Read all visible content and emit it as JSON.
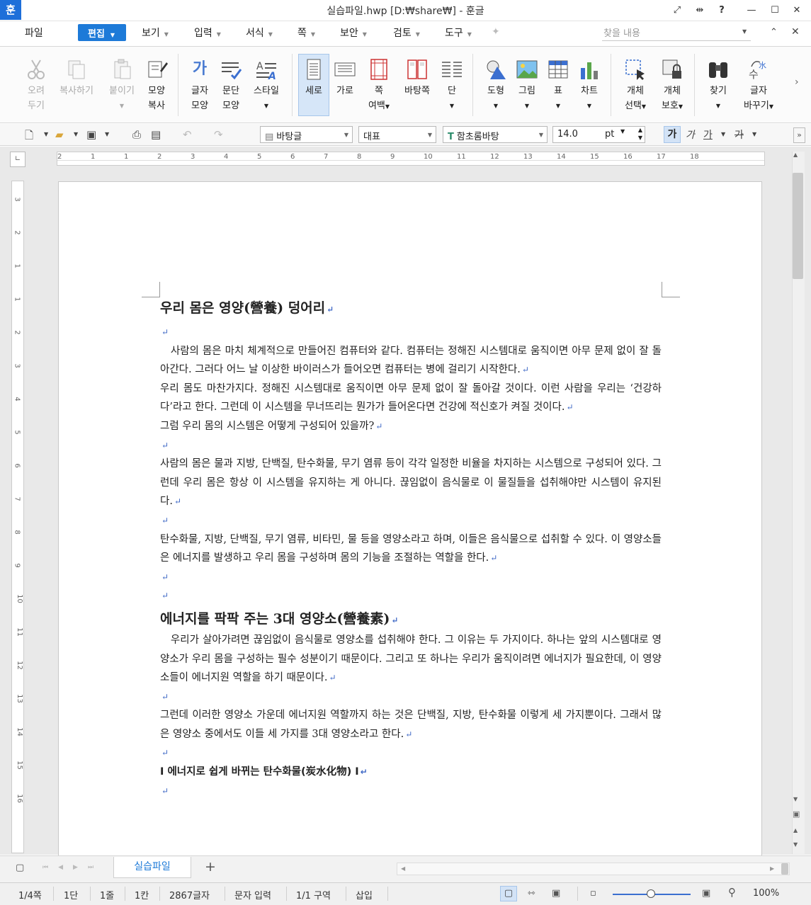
{
  "window": {
    "logo": "훈",
    "title": "실습파일.hwp [D:₩share₩] - 훈글",
    "controls": [
      "⤢",
      "⇹",
      "?",
      "—",
      "☐",
      "✕"
    ]
  },
  "menu": {
    "file": "파일",
    "edit": "편집",
    "items": [
      "보기",
      "입력",
      "서식",
      "쪽",
      "보안",
      "검토",
      "도구"
    ],
    "search_placeholder": "찾을 내용"
  },
  "ribbon": {
    "cut": [
      "오려",
      "두기"
    ],
    "copy": "복사하기",
    "paste": "붙이기",
    "format_copy": [
      "모양",
      "복사"
    ],
    "char_shape": [
      "글자",
      "모양"
    ],
    "para_shape": [
      "문단",
      "모양"
    ],
    "style": "스타일",
    "portrait": "세로",
    "landscape": "가로",
    "margins": [
      "쪽",
      "여백"
    ],
    "background": "바탕쪽",
    "columns": "단",
    "shape": "도형",
    "picture": "그림",
    "table": "표",
    "chart": "차트",
    "select_obj": [
      "개체",
      "선택"
    ],
    "protect_obj": [
      "개체",
      "보호"
    ],
    "find": "찾기",
    "replace": [
      "글자",
      "바꾸기"
    ]
  },
  "toolbar": {
    "style": "바탕글",
    "lang": "대표",
    "font": "함초롬바탕",
    "size": "14.0",
    "unit": "pt",
    "bold": "가",
    "italic": "가",
    "underline": "가",
    "strike": "가"
  },
  "ruler": {
    "h_ticks": [
      "2",
      "1",
      "1",
      "2",
      "3",
      "4",
      "5",
      "6",
      "7",
      "8",
      "9",
      "10",
      "11",
      "12",
      "13",
      "14",
      "15",
      "16",
      "17",
      "18"
    ],
    "v_ticks": [
      "3",
      "2",
      "1",
      "1",
      "2",
      "3",
      "4",
      "5",
      "6",
      "7",
      "8",
      "9",
      "10",
      "11",
      "12",
      "13",
      "14",
      "15",
      "16"
    ]
  },
  "doc": {
    "title": "우리 몸은 영양(營養) 덩어리",
    "p1": "　사람의 몸은 마치 체계적으로 만들어진 컴퓨터와 같다. 컴퓨터는 정해진 시스템대로 움직이면 아무 문제 없이 잘 돌아간다. 그러다 어느 날 이상한 바이러스가 들어오면 컴퓨터는 병에 걸리기 시작한다.",
    "p2": "우리 몸도 마찬가지다. 정해진 시스템대로 움직이면 아무 문제 없이 잘 돌아갈 것이다. 이런 사람을 우리는 ‘건강하다’라고 한다. 그런데 이 시스템을 무너뜨리는 뭔가가 들어온다면 건강에 적신호가 켜질 것이다.",
    "p3": "그럼 우리 몸의 시스템은 어떻게 구성되어 있을까?",
    "p4": "사람의 몸은 물과 지방, 단백질, 탄수화물, 무기 염류 등이 각각 일정한 비율을 차지하는 시스템으로 구성되어 있다. 그런데 우리 몸은 항상 이 시스템을 유지하는 게 아니다. 끊임없이 음식물로 이 물질들을 섭취해야만 시스템이 유지된다.",
    "p5": "탄수화물, 지방, 단백질, 무기 염류, 비타민, 물 등을 영양소라고 하며, 이들은 음식물으로 섭취할 수 있다. 이 영양소들은 에너지를 발생하고 우리 몸을 구성하며 몸의 기능을 조절하는 역할을 한다.",
    "title2": "에너지를 팍팍 주는 3대 영양소(營養素)",
    "p6": "　우리가 살아가려면 끊임없이 음식물로 영양소를 섭취해야 한다. 그 이유는 두 가지이다. 하나는 앞의 시스템대로 영양소가 우리 몸을 구성하는 필수 성분이기 때문이다. 그리고 또 하나는 우리가 움직이려면 에너지가 필요한데, 이 영양소들이 에너지원 역할을 하기 때문이다.",
    "p7": "그런데 이러한 영양소 가운데 에너지원 역할까지 하는 것은 단백질, 지방, 탄수화물 이렇게 세 가지뿐이다. 그래서 많은 영양소 중에서도 이들 세 가지를 3대 영양소라고 한다.",
    "title3": "Ⅰ 에너지로 쉽게 바뀌는 탄수화물(炭水化物) Ⅰ",
    "para_mark": "↵"
  },
  "tabs": {
    "doc_tab": "실습파일",
    "add": "+"
  },
  "status": {
    "page": "1/4쪽",
    "col": "1단",
    "line": "1줄",
    "char": "1칸",
    "count": "2867글자",
    "mode": "문자 입력",
    "section": "1/1 구역",
    "insert": "삽입",
    "zoom": "100%"
  }
}
